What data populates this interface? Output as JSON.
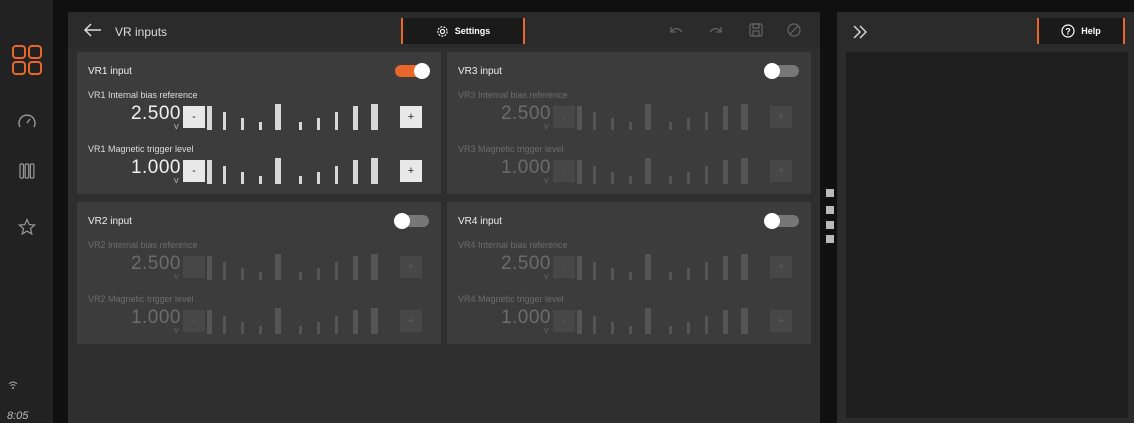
{
  "app": {
    "title": "VR inputs",
    "time": "8:05"
  },
  "toolbar": {
    "settings_label": "Settings",
    "help_label": "Help"
  },
  "colors": {
    "accent": "#e9672a",
    "panel": "#3c3c3c",
    "background": "#2e2e2e"
  },
  "icons": [
    "apps-icon",
    "gauge-icon",
    "columns-icon",
    "star-icon",
    "wifi-icon",
    "back-arrow-icon",
    "gear-icon",
    "undo-icon",
    "redo-icon",
    "save-icon",
    "disable-icon",
    "expand-icon",
    "help-icon"
  ],
  "cards": [
    {
      "title": "VR1 input",
      "enabled": true,
      "bias_label": "VR1 Internal bias reference",
      "bias_value": "2.500",
      "trigger_label": "VR1 Magnetic trigger level",
      "trigger_value": "1.000"
    },
    {
      "title": "VR2 input",
      "enabled": false,
      "bias_label": "VR2 Internal bias reference",
      "bias_value": "2.500",
      "trigger_label": "VR2 Magnetic trigger level",
      "trigger_value": "1.000"
    },
    {
      "title": "VR3 input",
      "enabled": false,
      "bias_label": "VR3 Internal bias reference",
      "bias_value": "2.500",
      "trigger_label": "VR3 Magnetic trigger level",
      "trigger_value": "1.000"
    },
    {
      "title": "VR4 input",
      "enabled": false,
      "bias_label": "VR4 Internal bias reference",
      "bias_value": "2.500",
      "trigger_label": "VR4 Magnetic trigger level",
      "trigger_value": "1.000"
    }
  ],
  "unit": "V",
  "buttons": {
    "minus": "-",
    "plus": "+"
  }
}
